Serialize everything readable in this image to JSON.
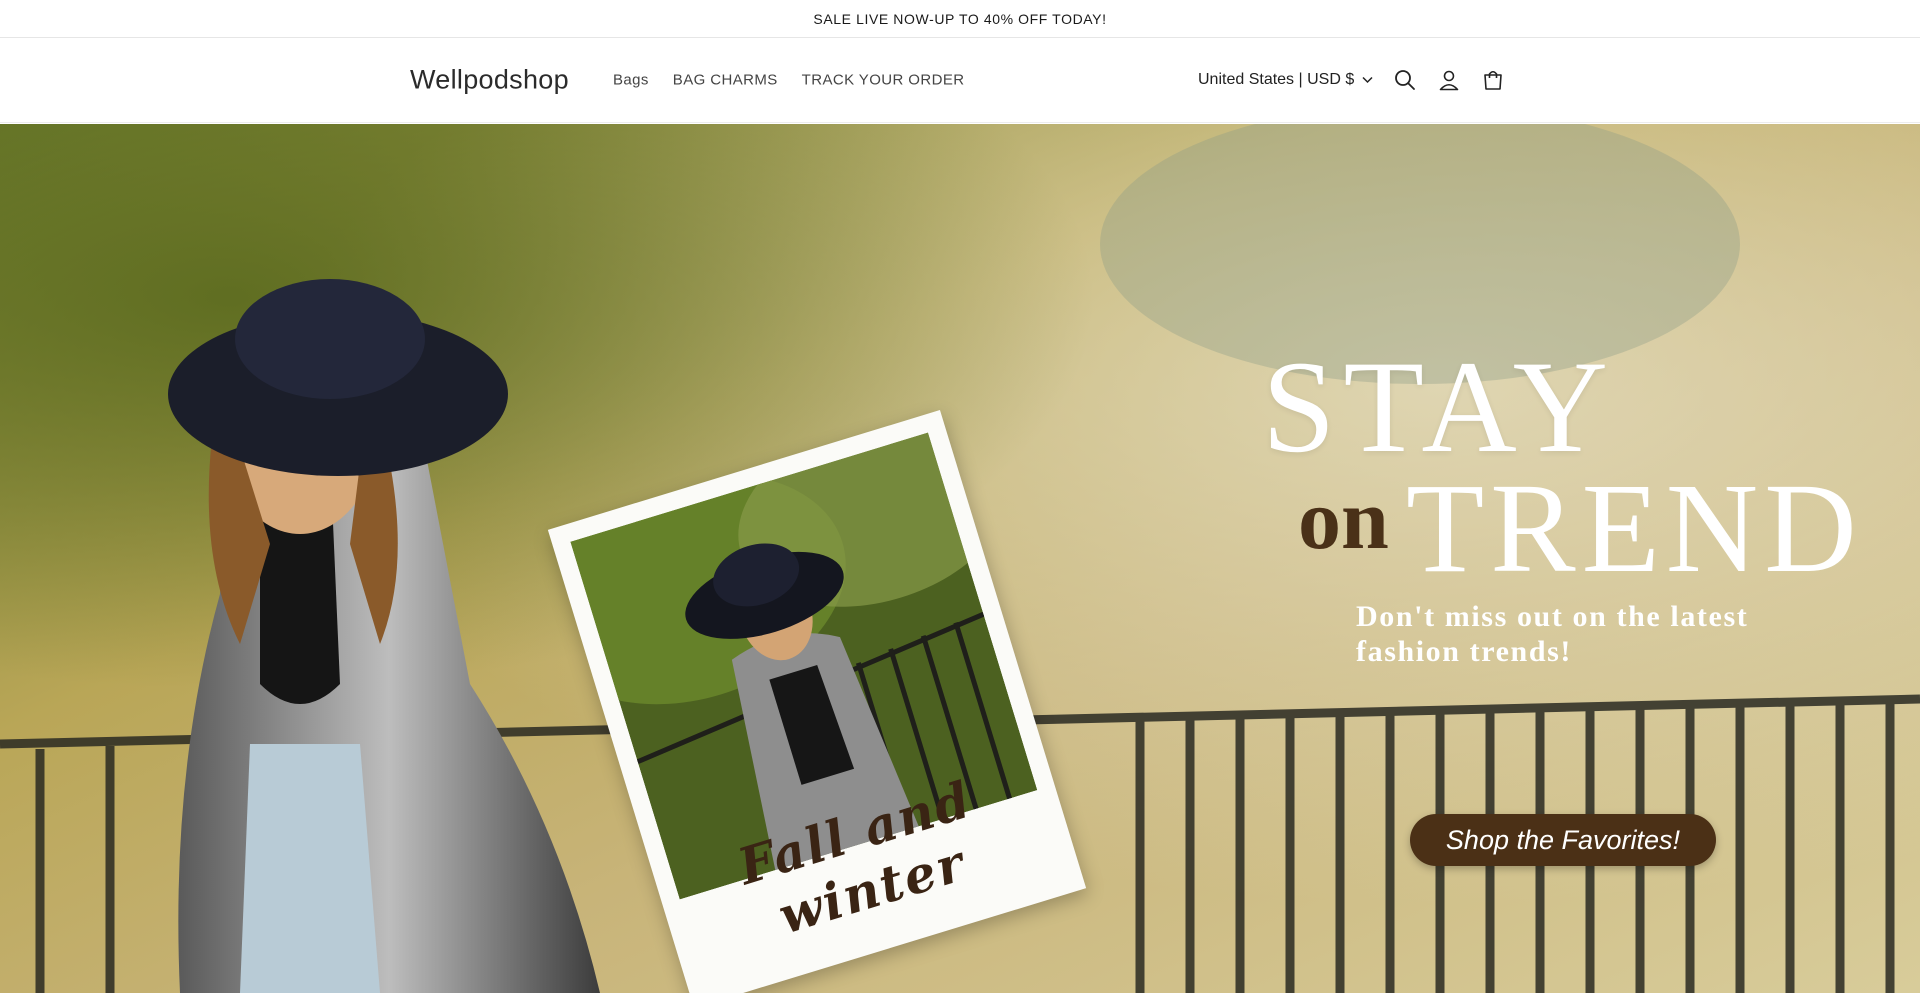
{
  "announcement": {
    "text": "SALE LIVE NOW-UP TO 40% OFF TODAY!"
  },
  "header": {
    "logo": "Wellpodshop",
    "nav": [
      {
        "label": "Bags"
      },
      {
        "label": "BAG CHARMS"
      },
      {
        "label": "TRACK YOUR ORDER"
      }
    ],
    "country_selector": "United States | USD $",
    "icons": [
      "search-icon",
      "account-icon",
      "cart-icon",
      "chevron-down-icon"
    ]
  },
  "hero": {
    "headline_line1": "STAY",
    "headline_on": "on",
    "headline_line2": "TREND",
    "subtext_line1": "Don't miss out on the latest",
    "subtext_line2": "fashion trends!",
    "polaroid_caption": "Fall and winter",
    "cta_label": "Shop the Favorites!"
  },
  "colors": {
    "cta_background": "#4b3016",
    "accent_brown": "#4a3118",
    "text_dark": "#222222"
  }
}
